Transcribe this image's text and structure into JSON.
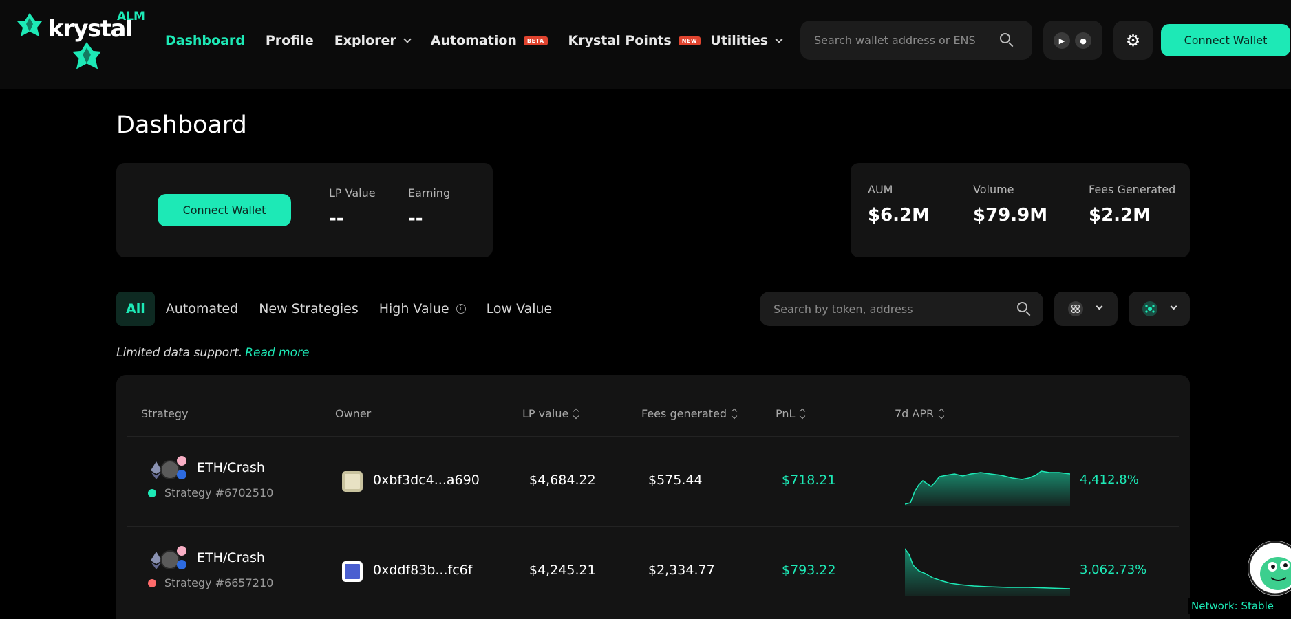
{
  "brand": {
    "name": "krystal",
    "tag": "ALM"
  },
  "nav": {
    "dashboard": "Dashboard",
    "profile": "Profile",
    "explorer": "Explorer",
    "automation": "Automation",
    "automation_badge": "BETA",
    "points": "Krystal Points",
    "points_badge": "NEW",
    "utilities": "Utilities"
  },
  "header": {
    "search_placeholder": "Search wallet address or ENS",
    "connect_label": "Connect Wallet"
  },
  "page": {
    "title": "Dashboard"
  },
  "wallet_card": {
    "connect_label": "Connect Wallet",
    "lp_value_label": "LP Value",
    "lp_value": "--",
    "earning_label": "Earning",
    "earning": "--"
  },
  "stats_card": {
    "aum_label": "AUM",
    "aum": "$6.2M",
    "volume_label": "Volume",
    "volume": "$79.9M",
    "fees_label": "Fees Generated",
    "fees": "$2.2M"
  },
  "filters": {
    "tabs": [
      "All",
      "Automated",
      "New Strategies",
      "High Value",
      "Low Value"
    ],
    "search_placeholder": "Search by token, address"
  },
  "notice": {
    "text": "Limited data support.",
    "link": "Read more"
  },
  "table": {
    "headers": [
      "Strategy",
      "Owner",
      "LP value",
      "Fees generated",
      "PnL",
      "7d APR"
    ],
    "rows": [
      {
        "pair": "ETH/Crash",
        "strategy": "Strategy #6702510",
        "status_color": "#1de9b6",
        "owner": "0xbf3dc4...a690",
        "lp_value": "$4,684.22",
        "fees": "$575.44",
        "pnl": "$718.21",
        "apr": "4,412.8%"
      },
      {
        "pair": "ETH/Crash",
        "strategy": "Strategy #6657210",
        "status_color": "#ff6b6b",
        "owner": "0xddf83b...fc6f",
        "lp_value": "$4,245.21",
        "fees": "$2,334.77",
        "pnl": "$793.22",
        "apr": "3,062.73%"
      }
    ]
  },
  "status": {
    "network": "Network: Stable"
  },
  "colors": {
    "accent": "#1de9b6",
    "background": "#000000",
    "card": "#141414",
    "danger": "#e0442f"
  }
}
